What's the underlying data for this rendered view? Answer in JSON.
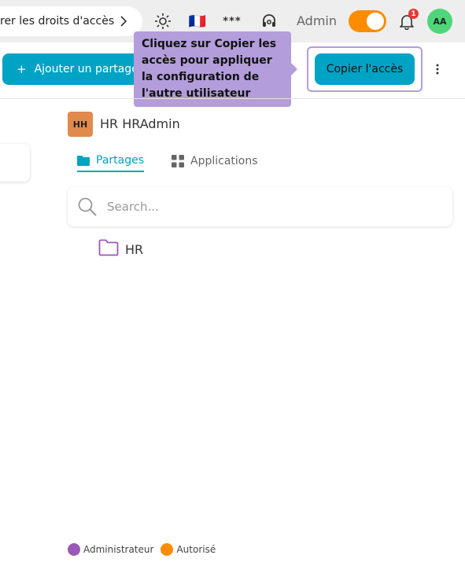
{
  "topbar": {
    "breadcrumb": "rer les droits d'accès",
    "language_flag": "🇫🇷",
    "password_mask": "***",
    "mode_label": "Admin",
    "mode_toggle_on": true,
    "notification_count": "1",
    "user_initials": "AA"
  },
  "actions": {
    "add_share_plus": "+",
    "add_share_label": "Ajouter un partage",
    "tooltip_text": "Cliquez sur Copier les accès pour appliquer la configuration de l'autre utilisateur",
    "copy_access_label": "Copier l'accès",
    "more_icon": "⋮"
  },
  "user": {
    "initials": "HH",
    "name": "HR HRAdmin"
  },
  "tabs": [
    {
      "label": "Partages",
      "icon": "folder-icon",
      "active": true
    },
    {
      "label": "Applications",
      "icon": "grid-icon",
      "active": false
    }
  ],
  "search": {
    "placeholder": "Search...",
    "value": ""
  },
  "folders": [
    {
      "label": "HR"
    }
  ],
  "legend": [
    {
      "label": "Administrateur",
      "color": "#9b59b6"
    },
    {
      "label": "Autorisé",
      "color": "#ff8c00"
    }
  ],
  "colors": {
    "accent": "#00a3c4",
    "tooltip": "#b39ddb",
    "toggle": "#ff8c00",
    "avatar_user": "#4fd67a",
    "avatar_hr": "#e08a4c"
  }
}
